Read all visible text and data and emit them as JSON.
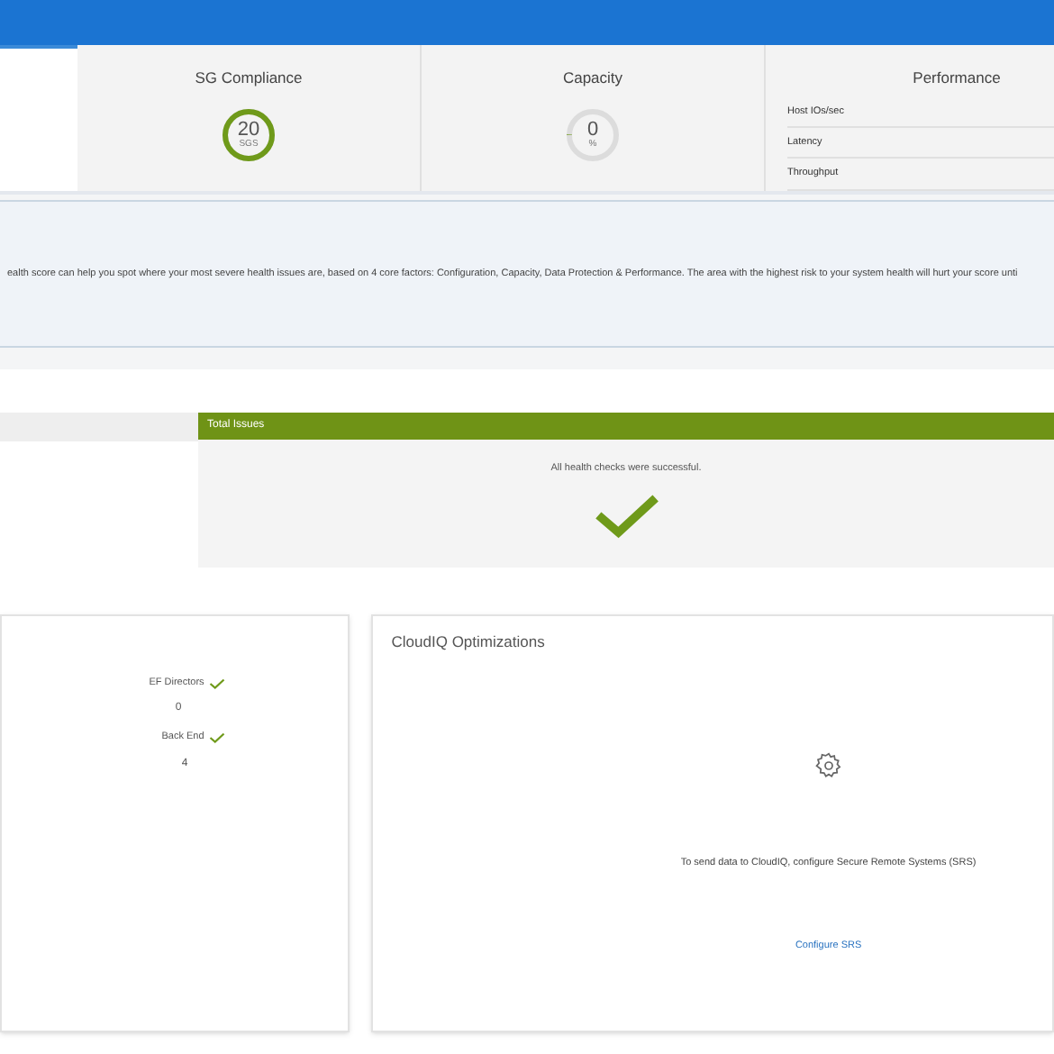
{
  "gauges": [
    {
      "title": "SG Compliance",
      "value": "20",
      "unit": "SGS",
      "level": 1
    },
    {
      "title": "Capacity",
      "value": "0",
      "unit": "%",
      "level": 0
    }
  ],
  "performance": {
    "title": "Performance",
    "rows": [
      "Host IOs/sec",
      "Latency",
      "Throughput"
    ]
  },
  "info": "ealth score can help you spot where your most severe health issues are, based on 4 core factors: Configuration, Capacity, Data Protection & Performance. The area with the highest risk to your system health will hurt your score unti",
  "total_issues": {
    "title": "Total Issues",
    "message": "All health checks were successful."
  },
  "hardware": [
    {
      "label": "EF Directors",
      "ok": true,
      "value": "0"
    },
    {
      "label": "Back End",
      "ok": true,
      "value": "4"
    }
  ],
  "cloudiq": {
    "title": "CloudIQ Optimizations",
    "message": "To send data to CloudIQ, configure Secure Remote Systems (SRS)",
    "link": "Configure SRS"
  }
}
